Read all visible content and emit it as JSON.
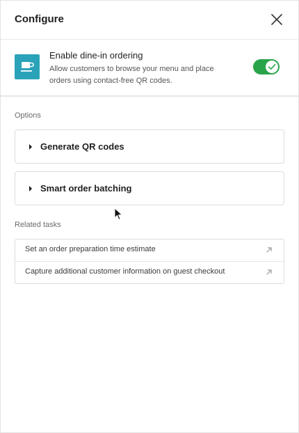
{
  "header": {
    "title": "Configure"
  },
  "feature": {
    "icon": "coffee-cup-icon",
    "title": "Enable dine-in ordering",
    "description": "Allow customers to browse your menu and place orders using contact-free QR codes.",
    "enabled": true,
    "toggle_color": "#2aa44a",
    "icon_color": "#2aa3b9"
  },
  "options": {
    "label": "Options",
    "items": [
      {
        "label": "Generate QR codes"
      },
      {
        "label": "Smart order batching"
      }
    ]
  },
  "related": {
    "label": "Related tasks",
    "items": [
      {
        "label": "Set an order preparation time estimate",
        "icon": "external-arrow-icon"
      },
      {
        "label": "Capture additional customer information on guest checkout",
        "icon": "external-arrow-icon"
      }
    ]
  }
}
